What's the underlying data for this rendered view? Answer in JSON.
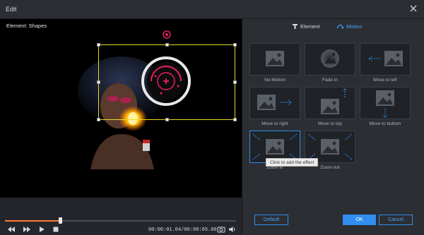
{
  "window": {
    "title": "Edit"
  },
  "preview": {
    "element_label": "Element: Shapes"
  },
  "player": {
    "time_current": "00:00:01.04",
    "time_total": "00:00:05.00",
    "progress": 0.24
  },
  "tabs": [
    {
      "label": "Element",
      "active": false
    },
    {
      "label": "Motion",
      "active": true
    }
  ],
  "motions": [
    {
      "label": "No Motion",
      "icon": "image-icon"
    },
    {
      "label": "Fade in",
      "icon": "fade-in-icon"
    },
    {
      "label": "Move to left",
      "icon": "move-left-icon"
    },
    {
      "label": "Move to right",
      "icon": "move-right-icon"
    },
    {
      "label": "Move to top",
      "icon": "move-top-icon"
    },
    {
      "label": "Move to bottom",
      "icon": "move-bottom-icon"
    },
    {
      "label": "Zoom in",
      "icon": "zoom-in-icon"
    },
    {
      "label": "Zoom out",
      "icon": "zoom-out-icon"
    }
  ],
  "tooltip": {
    "text": "Click to add the effect"
  },
  "buttons": {
    "default": "Default",
    "ok": "OK",
    "cancel": "Cancel"
  },
  "colors": {
    "accent": "#2f8ef0",
    "selection": "#e7d926",
    "progress": "#ff7a3a"
  }
}
